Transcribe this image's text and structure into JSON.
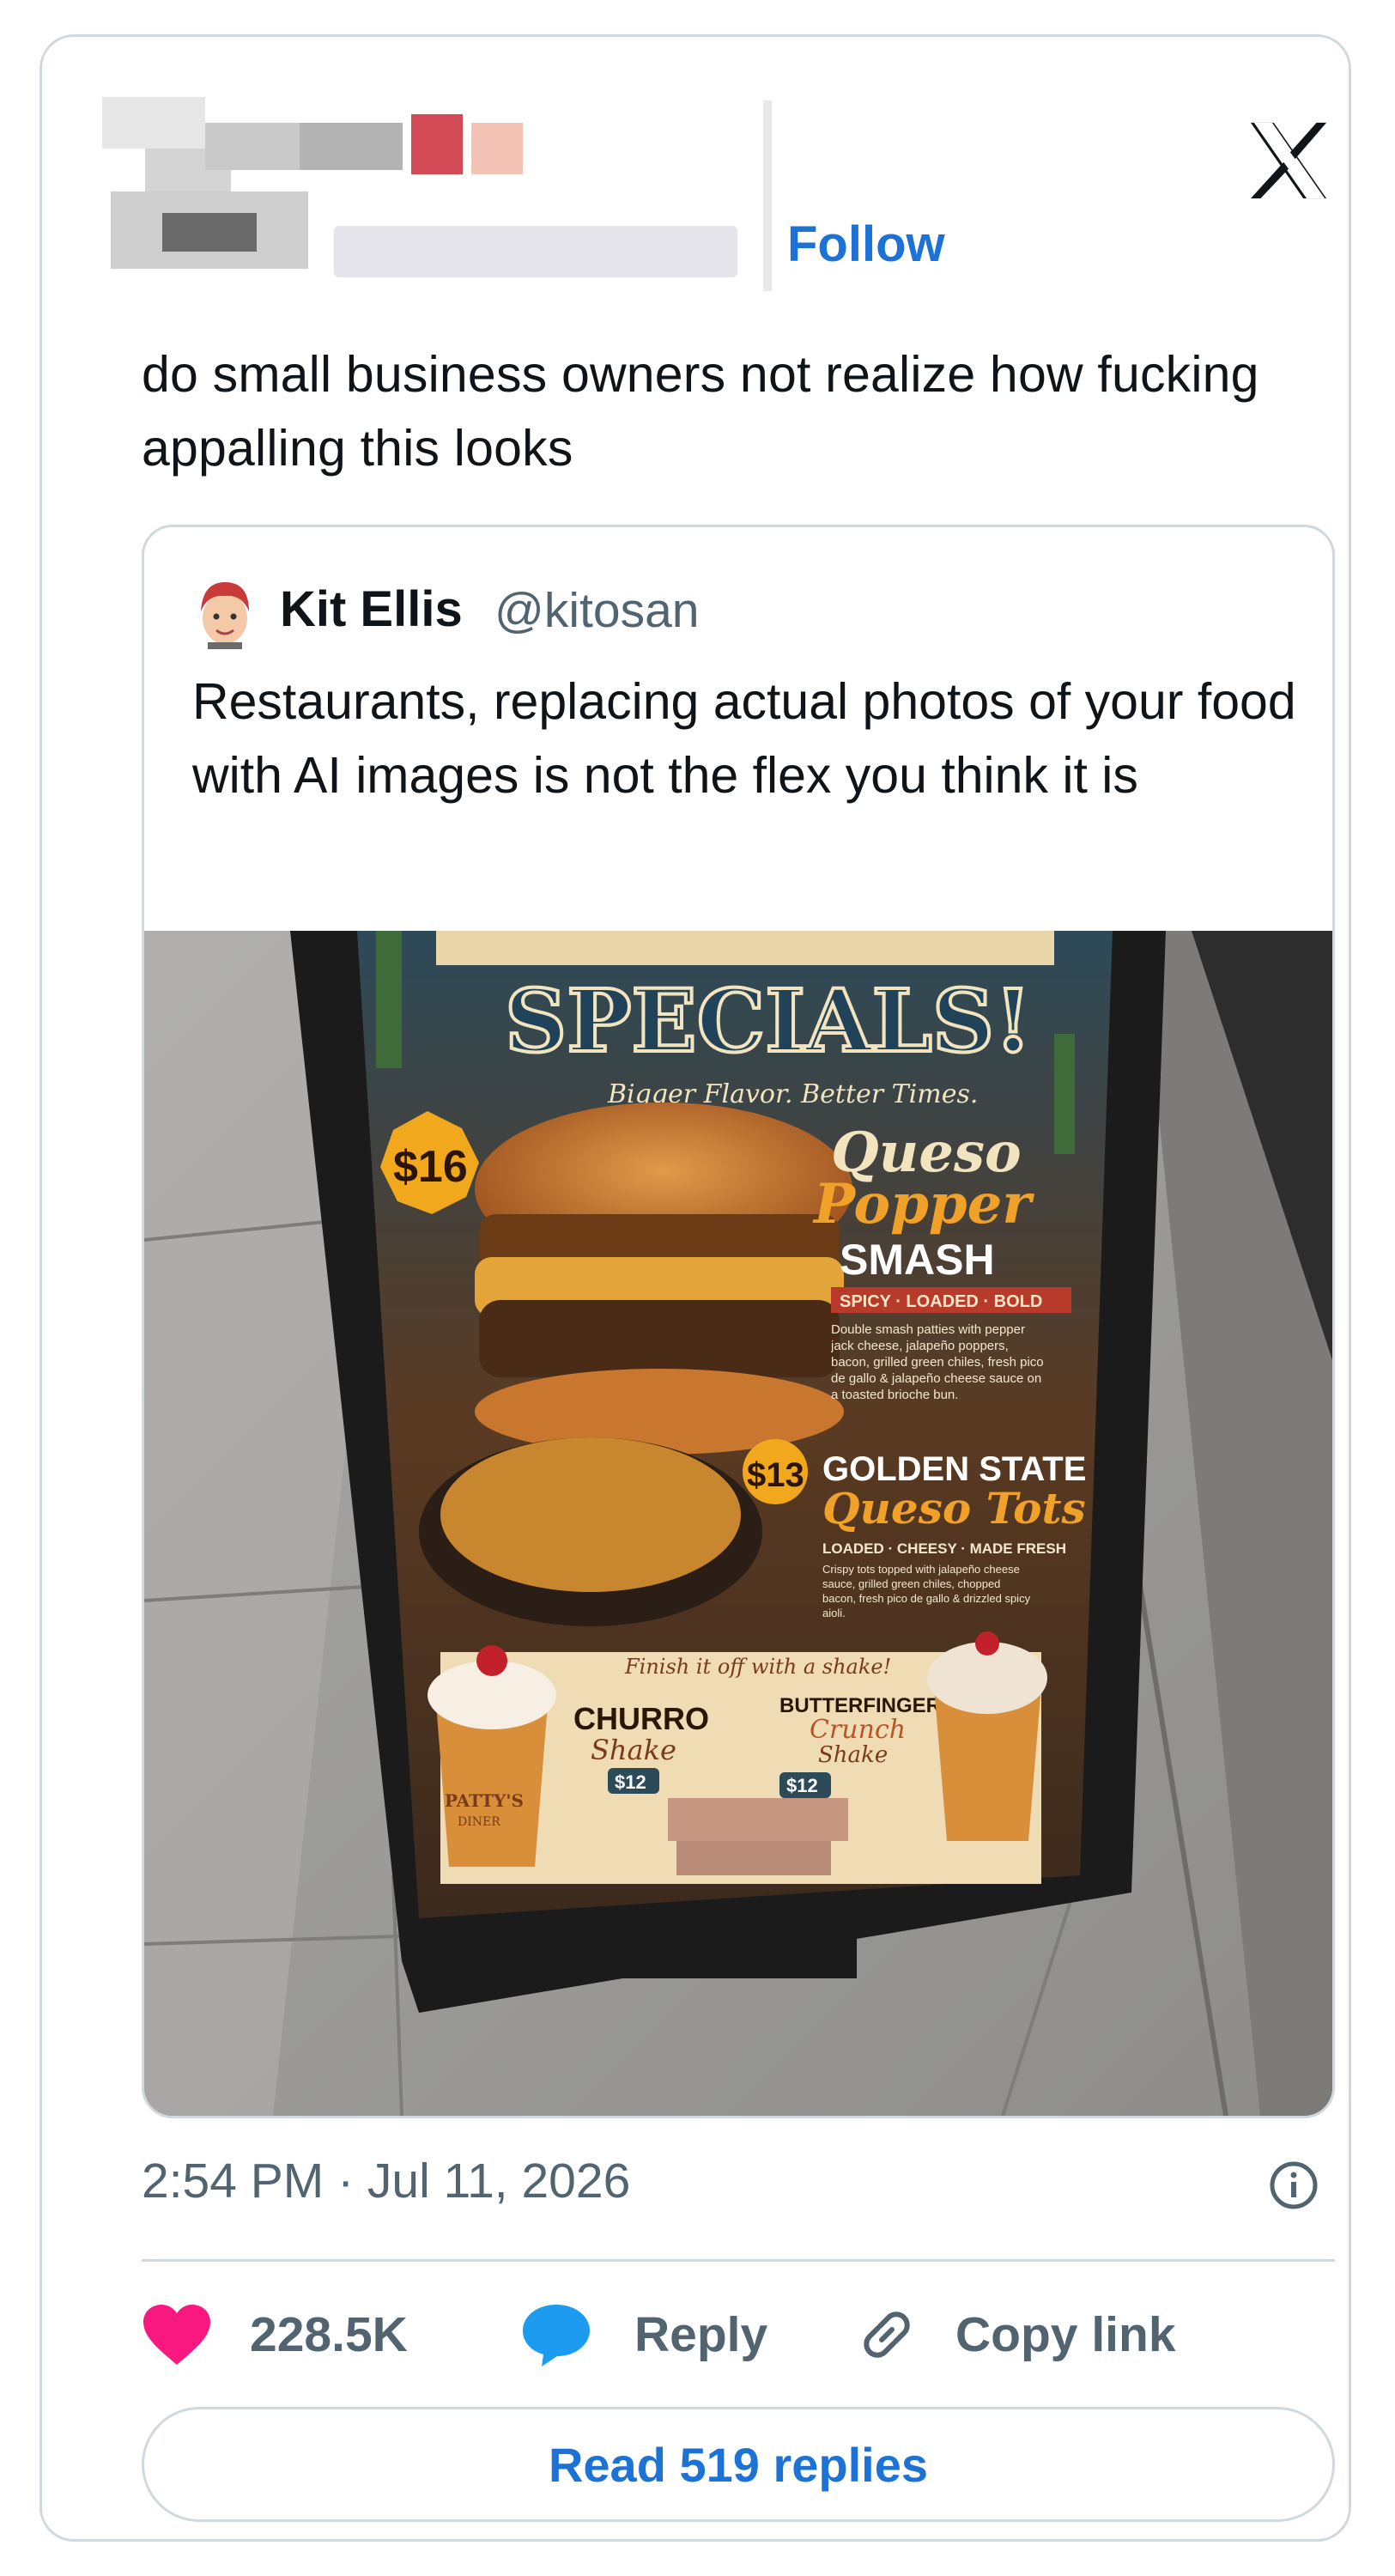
{
  "header": {
    "follow_label": "Follow",
    "close_icon": "x-logo-icon"
  },
  "tweet": {
    "text": "do small business owners not realize how fucking appalling this looks"
  },
  "quoted": {
    "name": "Kit Ellis",
    "handle": "@kitosan",
    "text": "Restaurants, replacing actual photos of your food with AI images is not the flex you think it is",
    "image": {
      "heading": "SPECIALS!",
      "tagline": "Bigger Flavor. Better Times.",
      "burger_price": "$16",
      "burger_name_1": "Queso",
      "burger_name_2": "Popper",
      "burger_name_3": "SMASH",
      "burger_tags": "SPICY · LOADED · BOLD",
      "burger_desc": "Double smash patties with pepper jack cheese, jalapeño poppers, bacon, grilled green chiles, fresh pico de gallo & jalapeño cheese sauce on a toasted brioche bun.",
      "tots_price": "$13",
      "tots_name_1": "GOLDEN STATE",
      "tots_name_2": "Queso Tots",
      "tots_tags": "LOADED · CHEESY · MADE FRESH",
      "tots_desc": "Crispy tots topped with jalapeño cheese sauce, grilled green chiles, chopped bacon, fresh pico de gallo & drizzled spicy aioli.",
      "shake_intro": "Finish it off with a shake!",
      "churro_name_1": "CHURRO",
      "churro_name_2": "Shake",
      "churro_price": "$12",
      "butter_name_1": "BUTTERFINGER",
      "butter_name_2": "Crunch",
      "butter_name_3": "Shake",
      "butter_price": "$12",
      "cup_label_1": "PATTY'S",
      "cup_label_2": "DINER"
    }
  },
  "meta": {
    "timestamp": "2:54 PM · Jul 11, 2026"
  },
  "actions": {
    "likes": "228.5K",
    "reply": "Reply",
    "copy": "Copy link"
  },
  "read_replies": "Read 519 replies",
  "colors": {
    "accent": "#1d72d6",
    "like": "#f91880",
    "reply_bubble": "#1d9bf0",
    "muted": "#536471",
    "border": "#cfd9de"
  }
}
